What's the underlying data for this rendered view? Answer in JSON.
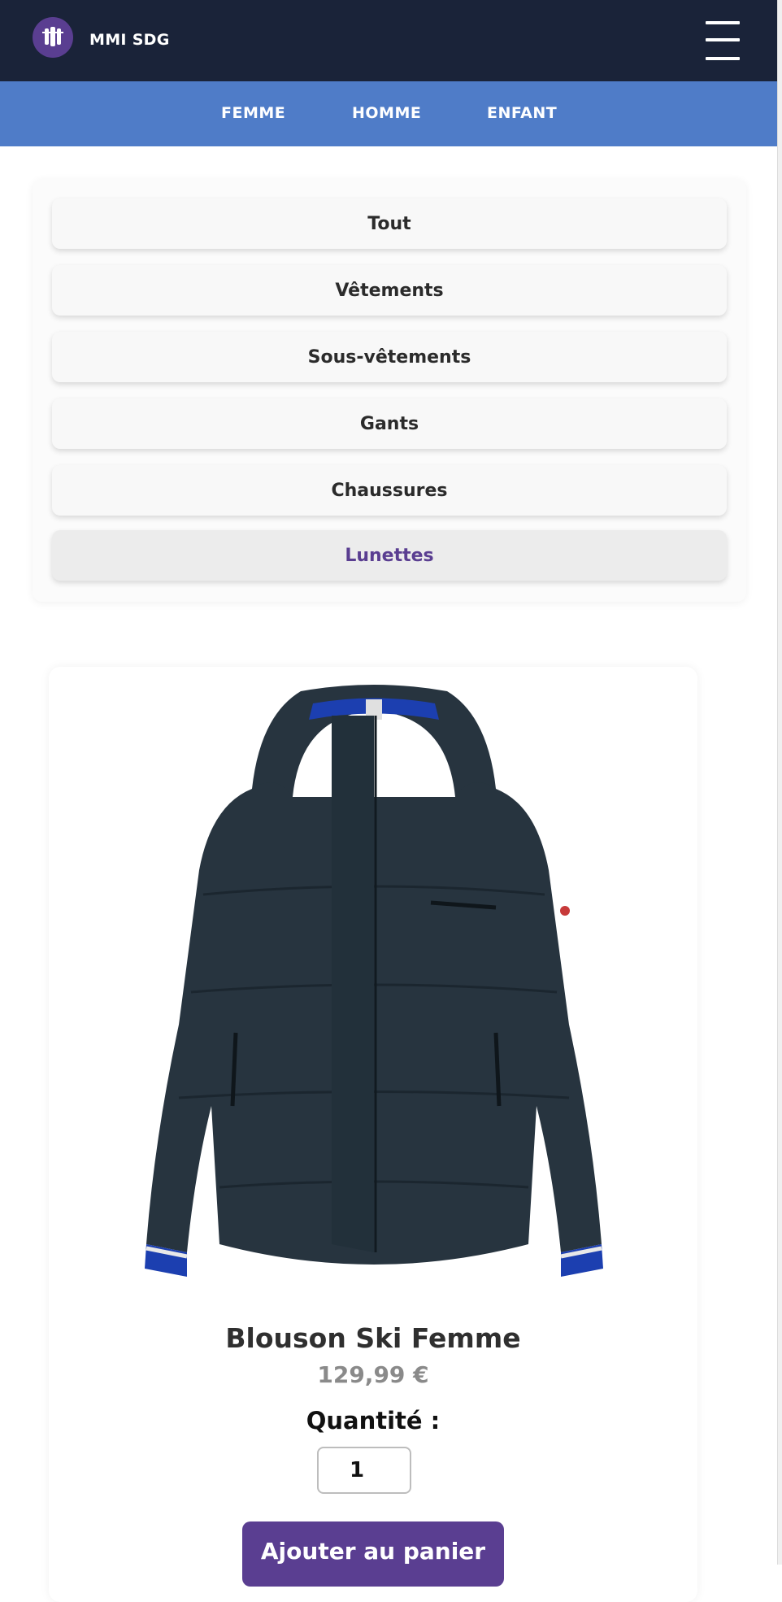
{
  "header": {
    "brand": "MMI SDG",
    "logo_icon": "ski-shop-logo-icon",
    "menu_icon": "hamburger-menu-icon"
  },
  "nav": {
    "items": [
      {
        "label": "FEMME"
      },
      {
        "label": "HOMME"
      },
      {
        "label": "ENFANT"
      }
    ]
  },
  "filters": {
    "items": [
      {
        "label": "Tout"
      },
      {
        "label": "Vêtements"
      },
      {
        "label": "Sous-vêtements"
      },
      {
        "label": "Gants"
      },
      {
        "label": "Chaussures"
      },
      {
        "label": "Lunettes"
      }
    ],
    "active": "Lunettes"
  },
  "product": {
    "name": "Blouson Ski Femme",
    "price": "129,99 €",
    "quantity_label": "Quantité :",
    "quantity_value": "1",
    "add_to_cart_label": "Ajouter au panier",
    "image_icon": "ski-jacket-image"
  },
  "colors": {
    "topbar": "#1a2339",
    "nav": "#4f7cc8",
    "accent": "#5a3e91",
    "price": "#8a8a8a",
    "jacket": "#27343f"
  }
}
